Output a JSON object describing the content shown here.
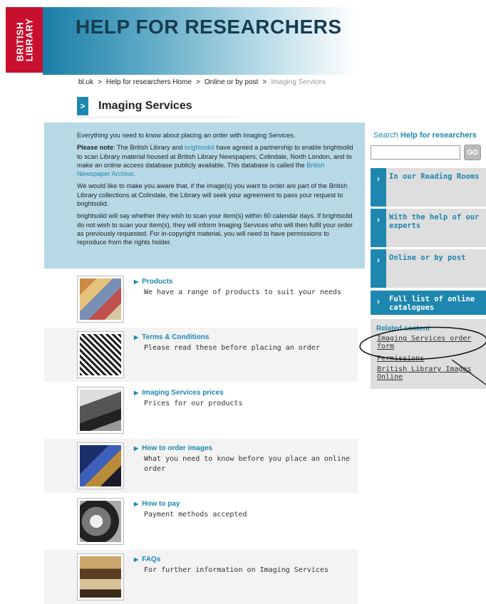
{
  "logo": {
    "line1": "BRITISH",
    "line2": "LIBRARY"
  },
  "header": {
    "title": "HELP FOR RESEARCHERS"
  },
  "breadcrumb": {
    "items": [
      "bl.uk",
      "Help for researchers Home",
      "Online or by post"
    ],
    "current": "Imaging Services",
    "separator": ">"
  },
  "page": {
    "title": "Imaging Services",
    "arrow": ">"
  },
  "notice": {
    "p1": "Everything you need to know about placing an order with Imaging Services.",
    "p2_bold": "Please note",
    "p2_a": ": The British Library and ",
    "p2_link1": "brightsolid",
    "p2_b": " have agreed a partnership to enable brightsolid to scan Library material housed at British Library Newspapers, Colindale, North London, and to make an online access database publicly available. This database is called the ",
    "p2_link2": "British Newspaper Archive",
    "p2_c": ".",
    "p3": "We would like to make you aware that, if the image(s) you want to order are part of the British Library collections at Colindale, the Library will seek your agreement to pass your request to brightsolid.",
    "p4": "brightsolid will say whether they wish to scan your item(s) within 60 calendar days. If brightsolid do not wish to scan your item(s), they will inform Imaging Services who will then fulfil your order as previously requested. For in-copyright material, you will need to have permissions to reproduce from the rights holder."
  },
  "items": [
    {
      "title": "Products",
      "desc": "We have a range of products to suit your needs"
    },
    {
      "title": "Terms & Conditions",
      "desc": "Please read these before placing an order"
    },
    {
      "title": "Imaging Services prices",
      "desc": "Prices for our products"
    },
    {
      "title": "How to order images",
      "desc": "What you need to know before you place an online order"
    },
    {
      "title": "How to pay",
      "desc": "Payment methods accepted"
    },
    {
      "title": "FAQs",
      "desc": "For further information on Imaging Services"
    }
  ],
  "sidebar": {
    "search_prefix": "Search ",
    "search_bold": "Help for researchers",
    "go_label": "GO",
    "nav": [
      {
        "label": "In our Reading Rooms"
      },
      {
        "label": "With the help of our experts"
      },
      {
        "label": "Online or by post"
      },
      {
        "label": "Full list of online catalogues"
      }
    ],
    "related_title": "Related content",
    "related_links": [
      "Imaging Services order form",
      "Permissions",
      "British Library Images Online"
    ]
  },
  "colors": {
    "accent": "#1e87b0",
    "logo_red": "#c8102e",
    "notice_bg": "#b7d9e6",
    "sidebar_bg": "#dedede"
  }
}
